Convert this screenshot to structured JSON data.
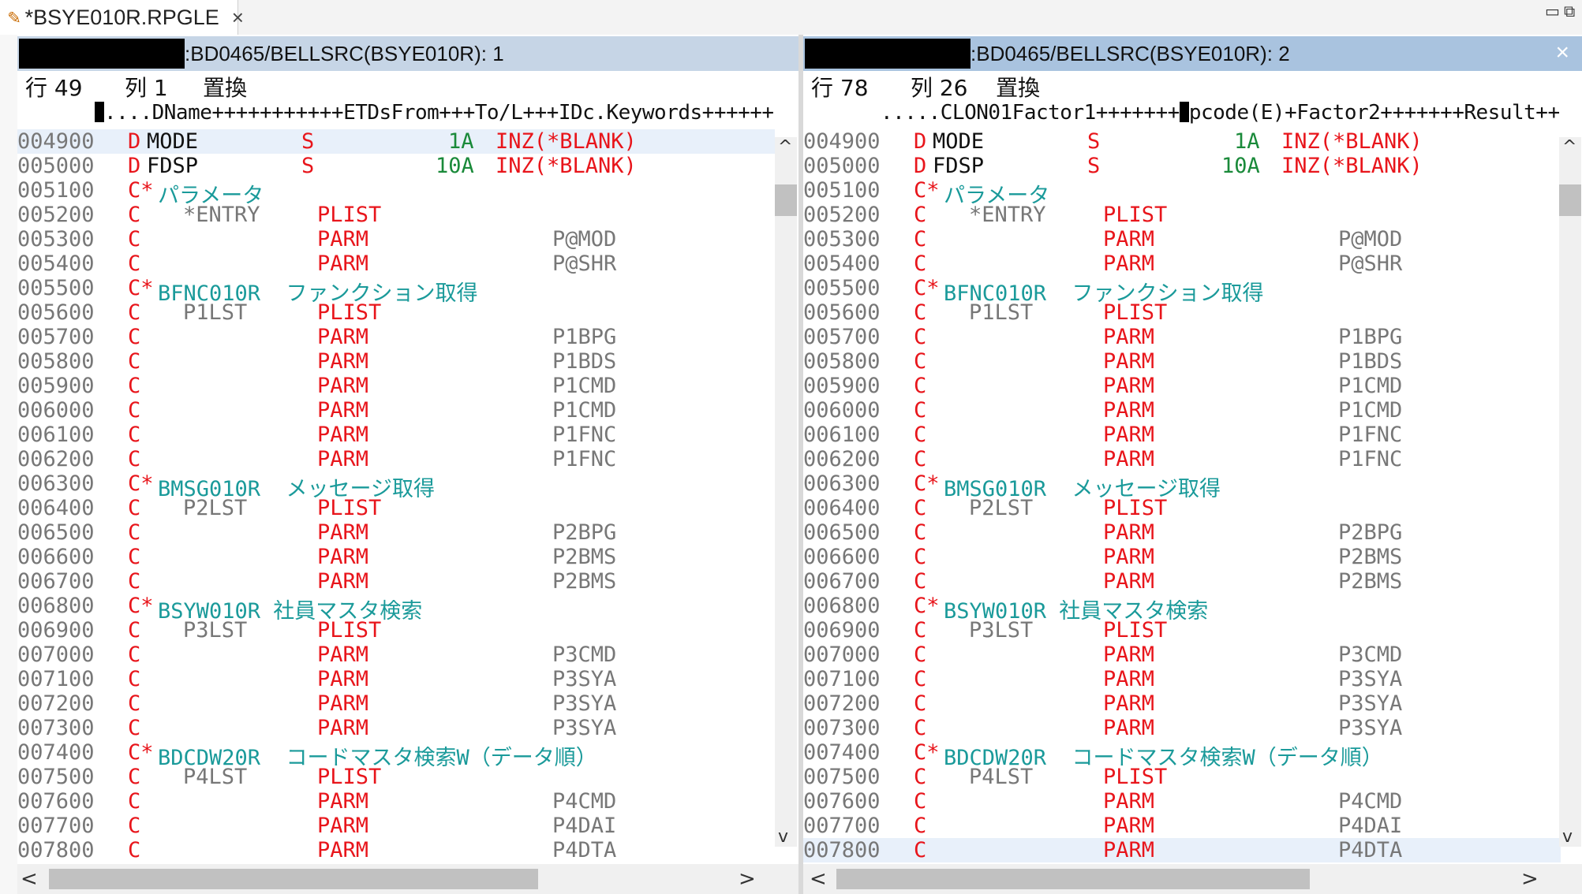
{
  "tab": {
    "title": "*BSYE010R.RPGLE",
    "close": "×"
  },
  "window_controls": {
    "minimize": "▭",
    "restore": "⧉"
  },
  "pane1": {
    "title": ":BD0465/BELLSRC(BSYE010R): 1",
    "status_row": "行 49",
    "status_col": "列 1",
    "status_mode": "置換",
    "ruler_cursor": "",
    "ruler": "....DName+++++++++++ETDsFrom+++To/L+++IDc.Keywords++++++",
    "lines": [
      {
        "seq": "004900",
        "spec": "D",
        "rest": "MODE",
        "type": "S",
        "len": "1A",
        "kw": "INZ(*BLANK)",
        "f2": ""
      },
      {
        "seq": "005000",
        "spec": "D",
        "rest": "FDSP",
        "type": "S",
        "len": "10A",
        "kw": "INZ(*BLANK)",
        "f2": ""
      },
      {
        "seq": "005100",
        "spec": "C*",
        "rest": "パラメータ",
        "type": "",
        "len": "",
        "kw": "",
        "f2": ""
      },
      {
        "seq": "005200",
        "spec": "C",
        "rest": "*ENTRY",
        "type": "PLIST",
        "len": "",
        "kw": "",
        "f2": ""
      },
      {
        "seq": "005300",
        "spec": "C",
        "rest": "",
        "type": "PARM",
        "len": "",
        "kw": "",
        "f2": "P@MOD"
      },
      {
        "seq": "005400",
        "spec": "C",
        "rest": "",
        "type": "PARM",
        "len": "",
        "kw": "",
        "f2": "P@SHR"
      },
      {
        "seq": "005500",
        "spec": "C*",
        "rest": "BFNC010R  ファンクション取得",
        "type": "",
        "len": "",
        "kw": "",
        "f2": ""
      },
      {
        "seq": "005600",
        "spec": "C",
        "rest": "P1LST",
        "type": "PLIST",
        "len": "",
        "kw": "",
        "f2": ""
      },
      {
        "seq": "005700",
        "spec": "C",
        "rest": "",
        "type": "PARM",
        "len": "",
        "kw": "",
        "f2": "P1BPG"
      },
      {
        "seq": "005800",
        "spec": "C",
        "rest": "",
        "type": "PARM",
        "len": "",
        "kw": "",
        "f2": "P1BDS"
      },
      {
        "seq": "005900",
        "spec": "C",
        "rest": "",
        "type": "PARM",
        "len": "",
        "kw": "",
        "f2": "P1CMD"
      },
      {
        "seq": "006000",
        "spec": "C",
        "rest": "",
        "type": "PARM",
        "len": "",
        "kw": "",
        "f2": "P1CMD"
      },
      {
        "seq": "006100",
        "spec": "C",
        "rest": "",
        "type": "PARM",
        "len": "",
        "kw": "",
        "f2": "P1FNC"
      },
      {
        "seq": "006200",
        "spec": "C",
        "rest": "",
        "type": "PARM",
        "len": "",
        "kw": "",
        "f2": "P1FNC"
      },
      {
        "seq": "006300",
        "spec": "C*",
        "rest": "BMSG010R  メッセージ取得",
        "type": "",
        "len": "",
        "kw": "",
        "f2": ""
      },
      {
        "seq": "006400",
        "spec": "C",
        "rest": "P2LST",
        "type": "PLIST",
        "len": "",
        "kw": "",
        "f2": ""
      },
      {
        "seq": "006500",
        "spec": "C",
        "rest": "",
        "type": "PARM",
        "len": "",
        "kw": "",
        "f2": "P2BPG"
      },
      {
        "seq": "006600",
        "spec": "C",
        "rest": "",
        "type": "PARM",
        "len": "",
        "kw": "",
        "f2": "P2BMS"
      },
      {
        "seq": "006700",
        "spec": "C",
        "rest": "",
        "type": "PARM",
        "len": "",
        "kw": "",
        "f2": "P2BMS"
      },
      {
        "seq": "006800",
        "spec": "C*",
        "rest": "BSYW010R 社員マスタ検索",
        "type": "",
        "len": "",
        "kw": "",
        "f2": ""
      },
      {
        "seq": "006900",
        "spec": "C",
        "rest": "P3LST",
        "type": "PLIST",
        "len": "",
        "kw": "",
        "f2": ""
      },
      {
        "seq": "007000",
        "spec": "C",
        "rest": "",
        "type": "PARM",
        "len": "",
        "kw": "",
        "f2": "P3CMD"
      },
      {
        "seq": "007100",
        "spec": "C",
        "rest": "",
        "type": "PARM",
        "len": "",
        "kw": "",
        "f2": "P3SYA"
      },
      {
        "seq": "007200",
        "spec": "C",
        "rest": "",
        "type": "PARM",
        "len": "",
        "kw": "",
        "f2": "P3SYA"
      },
      {
        "seq": "007300",
        "spec": "C",
        "rest": "",
        "type": "PARM",
        "len": "",
        "kw": "",
        "f2": "P3SYA"
      },
      {
        "seq": "007400",
        "spec": "C*",
        "rest": "BDCDW20R  コードマスタ検索W（データ順）",
        "type": "",
        "len": "",
        "kw": "",
        "f2": ""
      },
      {
        "seq": "007500",
        "spec": "C",
        "rest": "P4LST",
        "type": "PLIST",
        "len": "",
        "kw": "",
        "f2": ""
      },
      {
        "seq": "007600",
        "spec": "C",
        "rest": "",
        "type": "PARM",
        "len": "",
        "kw": "",
        "f2": "P4CMD"
      },
      {
        "seq": "007700",
        "spec": "C",
        "rest": "",
        "type": "PARM",
        "len": "",
        "kw": "",
        "f2": "P4DAI"
      },
      {
        "seq": "007800",
        "spec": "C",
        "rest": "",
        "type": "PARM",
        "len": "",
        "kw": "",
        "f2": "P4DTA"
      }
    ]
  },
  "pane2": {
    "title": ":BD0465/BELLSRC(BSYE010R): 2",
    "status_row": "行 78",
    "status_col": "列 26",
    "status_mode": "置換",
    "ruler_pre": ".....CLON01Factor1+++++++",
    "ruler_post": "pcode(E)+Factor2+++++++Result++",
    "lines": [
      {
        "seq": "004900",
        "spec": "D",
        "rest": "MODE",
        "type": "S",
        "len": "1A",
        "kw": "INZ(*BLANK)",
        "f2": ""
      },
      {
        "seq": "005000",
        "spec": "D",
        "rest": "FDSP",
        "type": "S",
        "len": "10A",
        "kw": "INZ(*BLANK)",
        "f2": ""
      },
      {
        "seq": "005100",
        "spec": "C*",
        "rest": "パラメータ",
        "type": "",
        "len": "",
        "kw": "",
        "f2": ""
      },
      {
        "seq": "005200",
        "spec": "C",
        "rest": "*ENTRY",
        "type": "PLIST",
        "len": "",
        "kw": "",
        "f2": ""
      },
      {
        "seq": "005300",
        "spec": "C",
        "rest": "",
        "type": "PARM",
        "len": "",
        "kw": "",
        "f2": "P@MOD"
      },
      {
        "seq": "005400",
        "spec": "C",
        "rest": "",
        "type": "PARM",
        "len": "",
        "kw": "",
        "f2": "P@SHR"
      },
      {
        "seq": "005500",
        "spec": "C*",
        "rest": "BFNC010R  ファンクション取得",
        "type": "",
        "len": "",
        "kw": "",
        "f2": ""
      },
      {
        "seq": "005600",
        "spec": "C",
        "rest": "P1LST",
        "type": "PLIST",
        "len": "",
        "kw": "",
        "f2": ""
      },
      {
        "seq": "005700",
        "spec": "C",
        "rest": "",
        "type": "PARM",
        "len": "",
        "kw": "",
        "f2": "P1BPG"
      },
      {
        "seq": "005800",
        "spec": "C",
        "rest": "",
        "type": "PARM",
        "len": "",
        "kw": "",
        "f2": "P1BDS"
      },
      {
        "seq": "005900",
        "spec": "C",
        "rest": "",
        "type": "PARM",
        "len": "",
        "kw": "",
        "f2": "P1CMD"
      },
      {
        "seq": "006000",
        "spec": "C",
        "rest": "",
        "type": "PARM",
        "len": "",
        "kw": "",
        "f2": "P1CMD"
      },
      {
        "seq": "006100",
        "spec": "C",
        "rest": "",
        "type": "PARM",
        "len": "",
        "kw": "",
        "f2": "P1FNC"
      },
      {
        "seq": "006200",
        "spec": "C",
        "rest": "",
        "type": "PARM",
        "len": "",
        "kw": "",
        "f2": "P1FNC"
      },
      {
        "seq": "006300",
        "spec": "C*",
        "rest": "BMSG010R  メッセージ取得",
        "type": "",
        "len": "",
        "kw": "",
        "f2": ""
      },
      {
        "seq": "006400",
        "spec": "C",
        "rest": "P2LST",
        "type": "PLIST",
        "len": "",
        "kw": "",
        "f2": ""
      },
      {
        "seq": "006500",
        "spec": "C",
        "rest": "",
        "type": "PARM",
        "len": "",
        "kw": "",
        "f2": "P2BPG"
      },
      {
        "seq": "006600",
        "spec": "C",
        "rest": "",
        "type": "PARM",
        "len": "",
        "kw": "",
        "f2": "P2BMS"
      },
      {
        "seq": "006700",
        "spec": "C",
        "rest": "",
        "type": "PARM",
        "len": "",
        "kw": "",
        "f2": "P2BMS"
      },
      {
        "seq": "006800",
        "spec": "C*",
        "rest": "BSYW010R 社員マスタ検索",
        "type": "",
        "len": "",
        "kw": "",
        "f2": ""
      },
      {
        "seq": "006900",
        "spec": "C",
        "rest": "P3LST",
        "type": "PLIST",
        "len": "",
        "kw": "",
        "f2": ""
      },
      {
        "seq": "007000",
        "spec": "C",
        "rest": "",
        "type": "PARM",
        "len": "",
        "kw": "",
        "f2": "P3CMD"
      },
      {
        "seq": "007100",
        "spec": "C",
        "rest": "",
        "type": "PARM",
        "len": "",
        "kw": "",
        "f2": "P3SYA"
      },
      {
        "seq": "007200",
        "spec": "C",
        "rest": "",
        "type": "PARM",
        "len": "",
        "kw": "",
        "f2": "P3SYA"
      },
      {
        "seq": "007300",
        "spec": "C",
        "rest": "",
        "type": "PARM",
        "len": "",
        "kw": "",
        "f2": "P3SYA"
      },
      {
        "seq": "007400",
        "spec": "C*",
        "rest": "BDCDW20R  コードマスタ検索W（データ順）",
        "type": "",
        "len": "",
        "kw": "",
        "f2": ""
      },
      {
        "seq": "007500",
        "spec": "C",
        "rest": "P4LST",
        "type": "PLIST",
        "len": "",
        "kw": "",
        "f2": ""
      },
      {
        "seq": "007600",
        "spec": "C",
        "rest": "",
        "type": "PARM",
        "len": "",
        "kw": "",
        "f2": "P4CMD"
      },
      {
        "seq": "007700",
        "spec": "C",
        "rest": "",
        "type": "PARM",
        "len": "",
        "kw": "",
        "f2": "P4DAI"
      },
      {
        "seq": "007800",
        "spec": "C",
        "rest": "",
        "type": "PARM",
        "len": "",
        "kw": "",
        "f2": "P4DTA"
      }
    ]
  },
  "scroll": {
    "up": "^",
    "down": "v",
    "left": "<",
    "right": ">"
  },
  "colors": {
    "spec": "#e8151b",
    "comment": "#1a9a9a",
    "gray": "#777777",
    "length": "#1a8a3a"
  }
}
